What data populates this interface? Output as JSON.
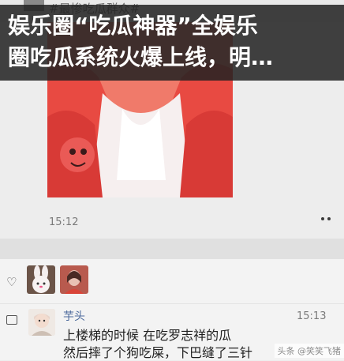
{
  "header_overlay": {
    "line1": "娱乐圈“吃瓜神器”全娱乐",
    "line2": "圈吃瓜系统火爆上线，明…"
  },
  "top_strip": {
    "hashtag": "#最惨吃瓜群众#"
  },
  "post": {
    "image_desc_icon": "photo-image",
    "timestamp": "15:12"
  },
  "likes": {
    "icon": "heart-icon",
    "avatars": [
      "rabbit-avatar",
      "portrait-avatar"
    ]
  },
  "comment": {
    "icon": "comment-icon",
    "author": "芋头",
    "time": "15:13",
    "lines": [
      "上楼梯的时候 在吃罗志祥的瓜",
      "然后摔了个狗吃屎，下巴缝了三针"
    ]
  },
  "watermark": "头条 @笑笑飞猪",
  "colors": {
    "overlay_bg": "#222222",
    "name_blue": "#4c6a9c",
    "photo_red": "#e8433e"
  }
}
